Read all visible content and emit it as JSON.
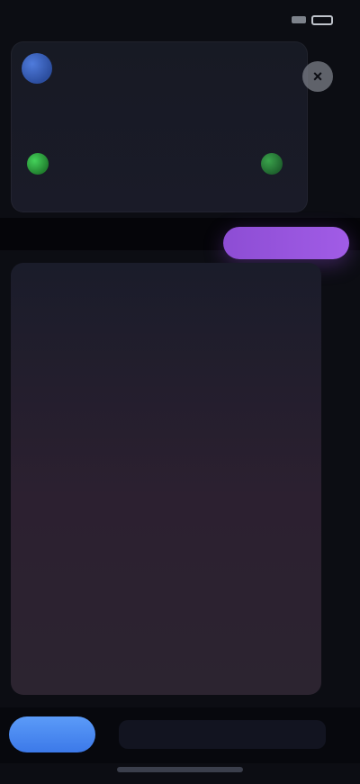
{
  "status": {
    "time": "",
    "right": ""
  },
  "card": {
    "title": "",
    "subtitle": "",
    "close_symbol": "×",
    "left_pill_label": "",
    "left_pill_meta": "",
    "right_pill_label": "",
    "right_pill_meta": ""
  },
  "actions": {
    "primary_label": "",
    "bottom_left_label": "",
    "input_placeholder": ""
  },
  "messages": [
    {
      "link": "",
      "text": ""
    },
    {
      "link": "",
      "text": ""
    },
    {
      "link": "",
      "text": ""
    },
    {
      "link": "",
      "text": ""
    },
    {
      "link": "",
      "text": ""
    },
    {
      "link": "",
      "text": ""
    },
    {
      "link": "",
      "text": ""
    },
    {
      "link": "",
      "text": ""
    },
    {
      "link": "",
      "text": ""
    },
    {
      "link": "",
      "text": ""
    }
  ],
  "colors": {
    "accent_purple": "#9b56e0",
    "accent_blue": "#4b7fe6",
    "success_green": "#44d25a",
    "background": "#0c0d13"
  },
  "icons": {
    "avatar": "avatar",
    "close": "close-icon",
    "status_left": "status-icon",
    "status_right": "battery-icon"
  }
}
